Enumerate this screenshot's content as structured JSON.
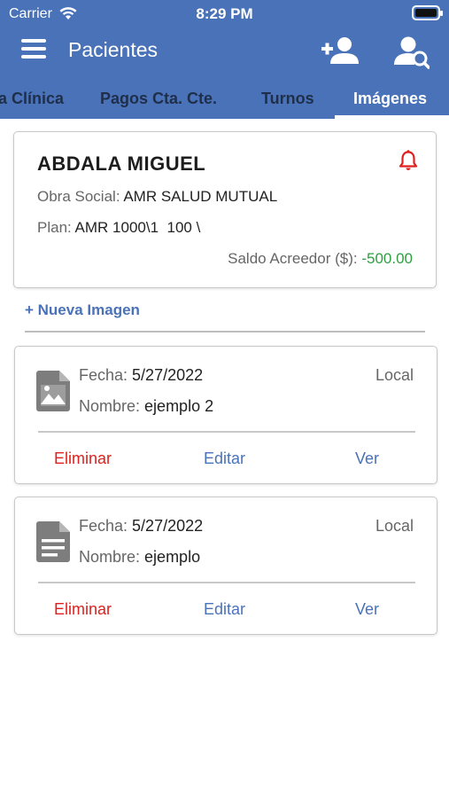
{
  "status_bar": {
    "carrier": "Carrier",
    "time": "8:29 PM"
  },
  "header": {
    "title": "Pacientes"
  },
  "tabs": [
    {
      "label": "a Clínica"
    },
    {
      "label": "Pagos Cta. Cte."
    },
    {
      "label": "Turnos"
    },
    {
      "label": "Imágenes",
      "active": true
    }
  ],
  "patient": {
    "name": "ABDALA MIGUEL",
    "obra_social_label": "Obra Social:",
    "obra_social": "AMR SALUD MUTUAL",
    "plan_label": "Plan:",
    "plan": "AMR 1000\\1  100 \\",
    "saldo_label": "Saldo Acreedor ($):",
    "saldo": "-500.00"
  },
  "new_image_label": "+ Nueva Imagen",
  "images": [
    {
      "icon": "image-icon",
      "fecha_label": "Fecha:",
      "fecha": "5/27/2022",
      "nombre_label": "Nombre:",
      "nombre": "ejemplo 2",
      "location": "Local",
      "delete_label": "Eliminar",
      "edit_label": "Editar",
      "view_label": "Ver"
    },
    {
      "icon": "document-icon",
      "fecha_label": "Fecha:",
      "fecha": "5/27/2022",
      "nombre_label": "Nombre:",
      "nombre": "ejemplo",
      "location": "Local",
      "delete_label": "Eliminar",
      "edit_label": "Editar",
      "view_label": "Ver"
    }
  ],
  "colors": {
    "primary": "#4a72b8",
    "danger": "#e0201e",
    "positive": "#2e9e3f",
    "alert": "#e0201e"
  }
}
